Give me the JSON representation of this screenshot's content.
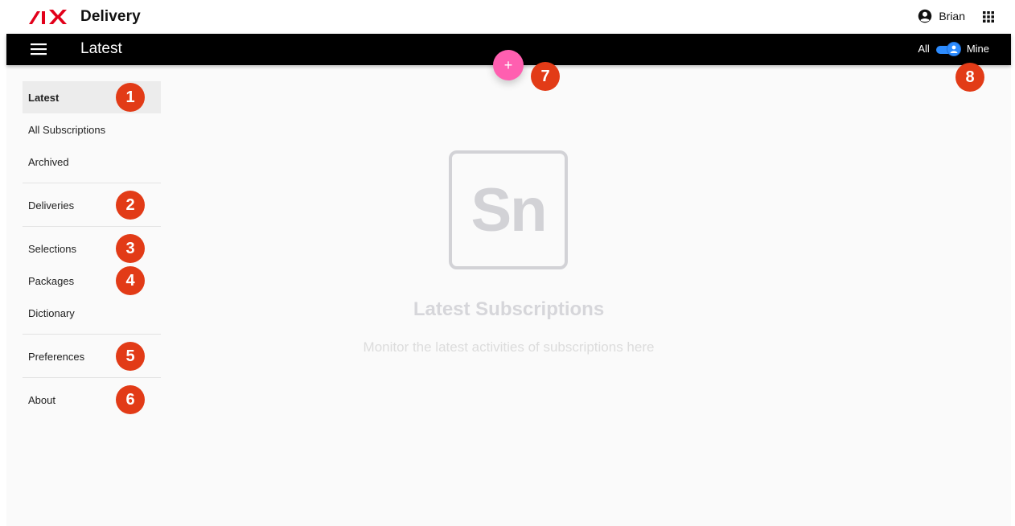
{
  "app": {
    "brand_mark": "SIX",
    "name": "Delivery"
  },
  "user": {
    "name": "Brian"
  },
  "toolbar": {
    "title": "Latest",
    "toggle_left": "All",
    "toggle_right": "Mine",
    "toggle_value": "Mine"
  },
  "fab": {
    "label": "+"
  },
  "sidebar": {
    "items": [
      {
        "label": "Latest",
        "active": true
      },
      {
        "label": "All Subscriptions"
      },
      {
        "label": "Archived"
      },
      {
        "label": "Deliveries"
      },
      {
        "label": "Selections"
      },
      {
        "label": "Packages"
      },
      {
        "label": "Dictionary"
      },
      {
        "label": "Preferences"
      },
      {
        "label": "About"
      }
    ]
  },
  "badges": [
    "1",
    "2",
    "3",
    "4",
    "5",
    "6",
    "7",
    "8"
  ],
  "empty_state": {
    "logo_text": "Sn",
    "title": "Latest Subscriptions",
    "subtitle": "Monitor the latest activities of subscriptions here"
  },
  "colors": {
    "toolbar_bg": "#000000",
    "fab": "#ff5fb0",
    "badge": "#e23b17",
    "toggle": "#2d8cff",
    "brand_red": "#e2001a"
  },
  "icons": {
    "user": "account-circle-icon",
    "apps": "apps-grid-icon",
    "menu": "hamburger-menu-icon",
    "toggle_thumb": "person-icon"
  }
}
